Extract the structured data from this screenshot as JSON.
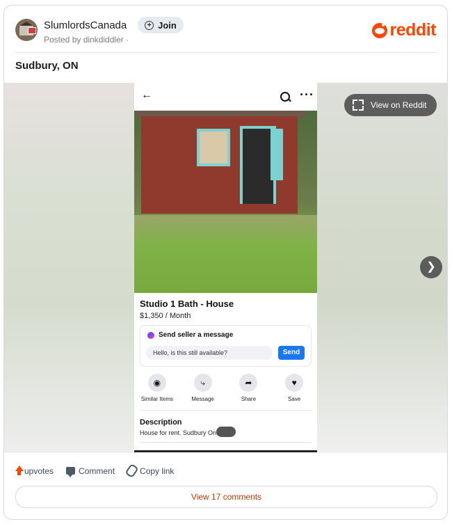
{
  "header": {
    "subreddit": "SlumlordsCanada",
    "join_label": "Join",
    "posted_by": "Posted by dinkdiddler ·",
    "brand": "reddit"
  },
  "post": {
    "title": "Sudbury, ON"
  },
  "media": {
    "view_label": "View on Reddit",
    "listing": {
      "title": "Studio 1 Bath - House",
      "price": "$1,350 / Month",
      "message_heading": "Send seller a message",
      "message_value": "Hello, is this still available?",
      "send_label": "Send",
      "actions": [
        "Similar Items",
        "Message",
        "Share",
        "Save"
      ],
      "description_heading": "Description",
      "description_text": "House for rent. Sudbury Ontario"
    }
  },
  "footer": {
    "upvotes": "upvotes",
    "comment": "Comment",
    "copy_link": "Copy link",
    "view_comments": "View 17 comments"
  },
  "colors": {
    "brand": "#ff4500",
    "send": "#1877f2"
  }
}
